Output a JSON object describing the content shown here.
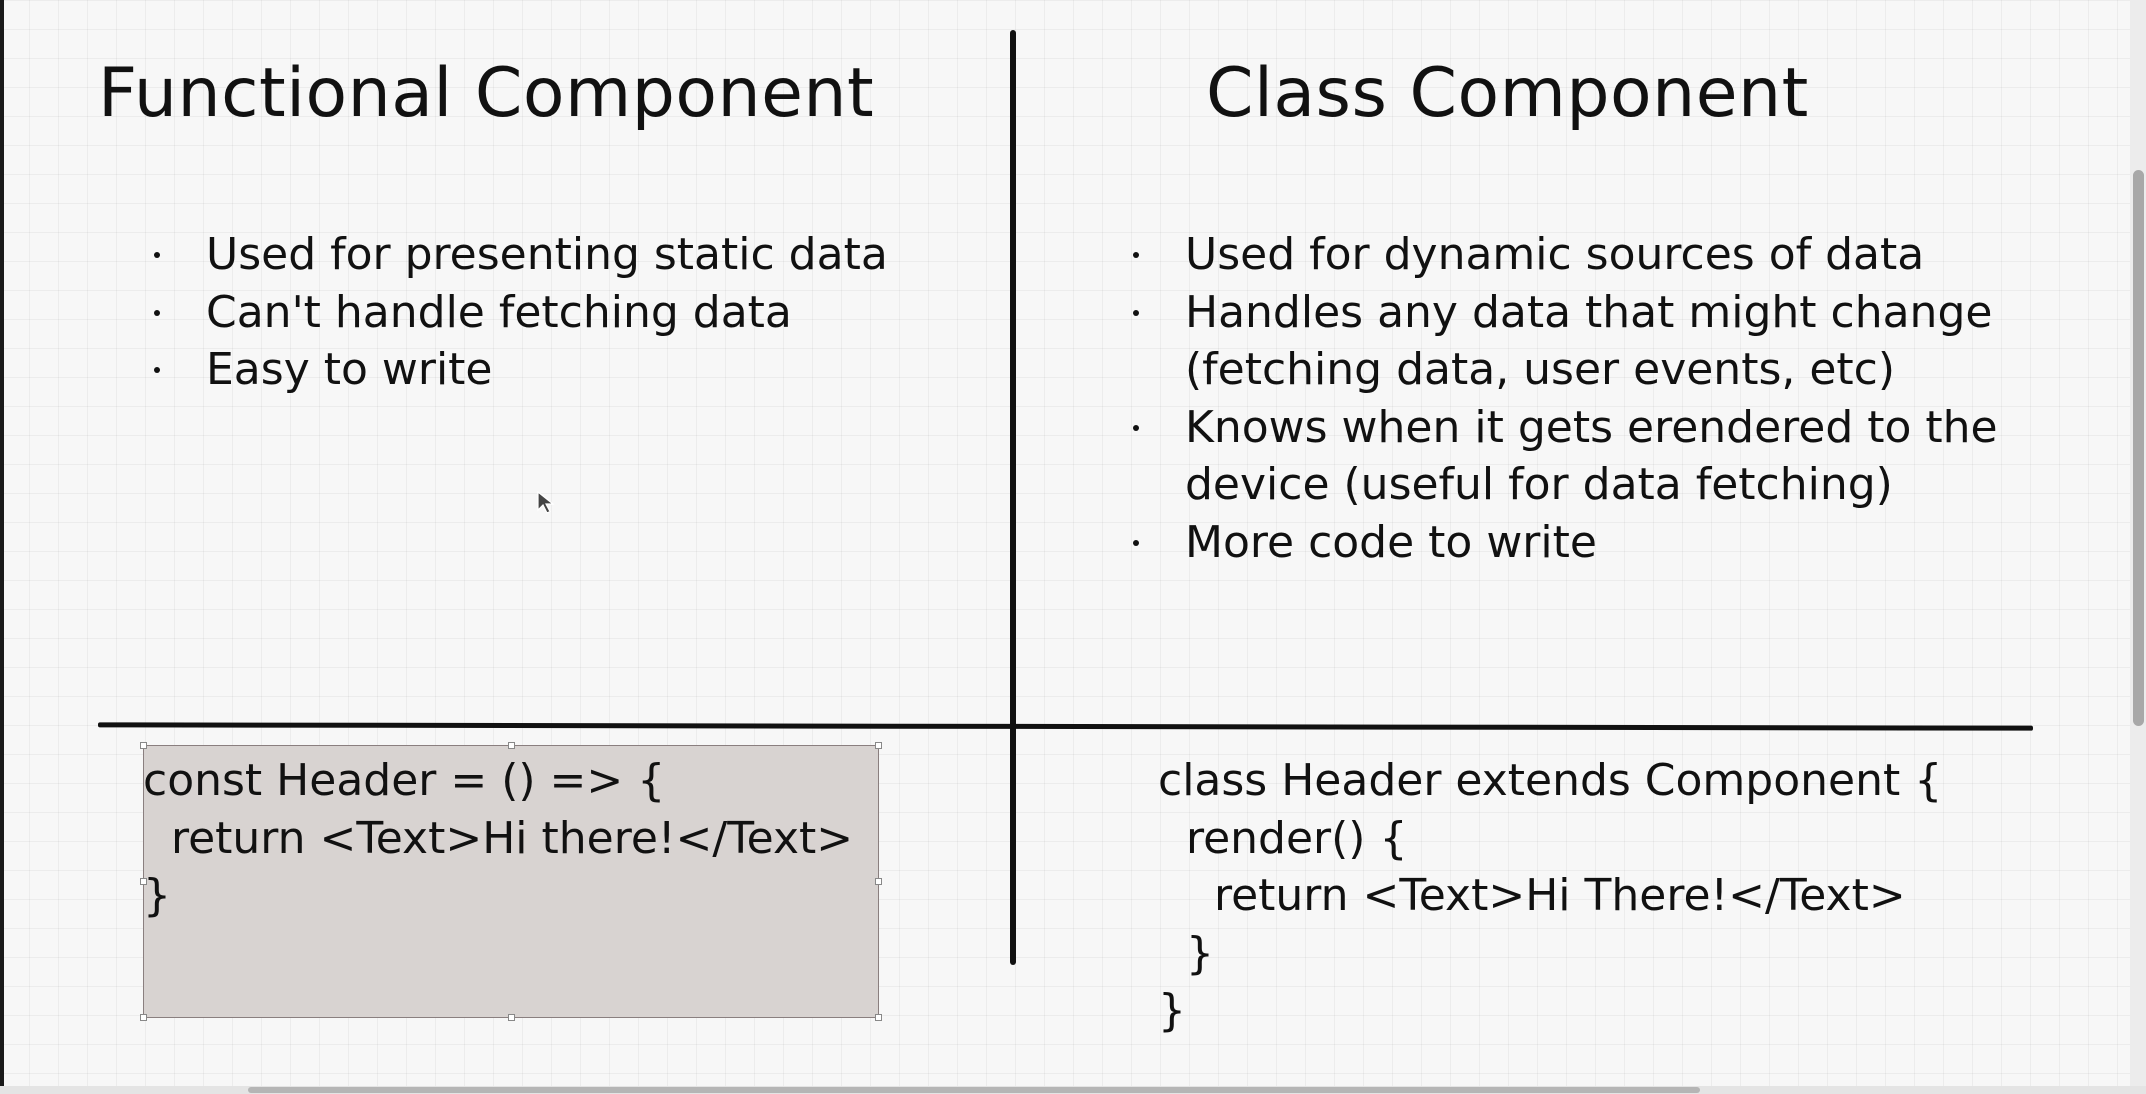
{
  "slide": {
    "left": {
      "title": "Functional Component",
      "bullets": [
        "Used for presenting static data",
        "Can't handle fetching data",
        "Easy to write"
      ],
      "code": "const Header = () => {\n  return <Text>Hi there!</Text>\n}"
    },
    "right": {
      "title": "Class Component",
      "bullets": [
        "Used for dynamic sources of data",
        "Handles any data that might change (fetching data, user events, etc)",
        "Knows when it gets erendered to the device (useful for data fetching)",
        "More code to write"
      ],
      "code": "class Header extends Component {\n  render() {\n    return <Text>Hi There!</Text>\n  }\n}"
    }
  },
  "colors": {
    "background": "#f7f7f7",
    "ink": "#111111",
    "selection_fill": "#d8d3d1"
  },
  "icons": {
    "cursor": "mouse-pointer-icon"
  }
}
